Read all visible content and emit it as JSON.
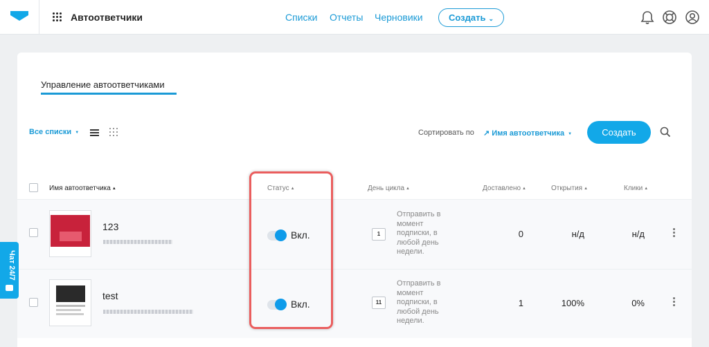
{
  "header": {
    "app_title": "Автоответчики",
    "nav": [
      "Списки",
      "Отчеты",
      "Черновики"
    ],
    "create_label": "Создать"
  },
  "toolbar": {
    "tab": "Управление автоответчиками",
    "filter": "Все списки",
    "sort_label": "Сортировать по",
    "sort_value": "Имя автоответчика",
    "create_label": "Создать"
  },
  "table": {
    "columns": [
      "Имя автоответчика",
      "Статус",
      "День цикла",
      "Доставлено",
      "Открытия",
      "Клики"
    ],
    "rows": [
      {
        "name": "123",
        "status": "Вкл.",
        "day": "1",
        "cycle_lines": [
          "Отправить в",
          "момент",
          "подписки, в",
          "любой день",
          "недели."
        ],
        "delivered": "0",
        "opens": "н/д",
        "clicks": "н/д"
      },
      {
        "name": "test",
        "status": "Вкл.",
        "day": "11",
        "cycle_lines": [
          "Отправить в",
          "момент",
          "подписки, в",
          "любой день",
          "недели."
        ],
        "delivered": "1",
        "opens": "100%",
        "clicks": "0%"
      }
    ]
  },
  "chat": {
    "label": "Чат 24/7"
  },
  "colors": {
    "accent": "#12a8e8",
    "highlight": "#ea5d5d"
  }
}
